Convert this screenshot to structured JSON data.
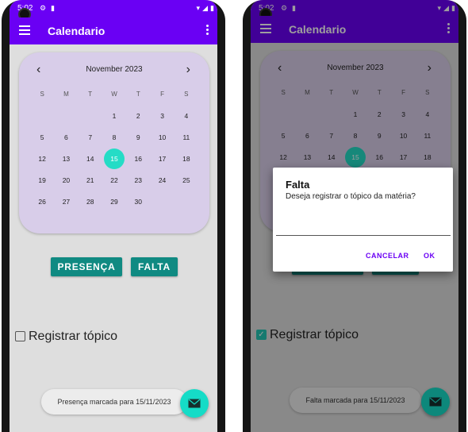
{
  "status_bar": {
    "time": "5:02"
  },
  "app_bar": {
    "title": "Calendario"
  },
  "calendar": {
    "month_label": "November 2023",
    "weekdays": [
      "S",
      "M",
      "T",
      "W",
      "T",
      "F",
      "S"
    ],
    "weeks": [
      [
        "",
        "",
        "",
        "1",
        "2",
        "3",
        "4"
      ],
      [
        "5",
        "6",
        "7",
        "8",
        "9",
        "10",
        "11"
      ],
      [
        "12",
        "13",
        "14",
        "15",
        "16",
        "17",
        "18"
      ],
      [
        "19",
        "20",
        "21",
        "22",
        "23",
        "24",
        "25"
      ],
      [
        "26",
        "27",
        "28",
        "29",
        "30",
        "",
        ""
      ]
    ],
    "selected_day": "15"
  },
  "buttons": {
    "presenca": "PRESENÇA",
    "falta": "FALTA"
  },
  "checkbox": {
    "label": "Registrar tópico"
  },
  "left_screen": {
    "checked": false,
    "toast": "Presença marcada para 15/11/2023"
  },
  "right_screen": {
    "checked": true,
    "toast": "Falta marcada para 15/11/2023"
  },
  "dialog": {
    "title": "Falta",
    "message": "Deseja registrar o tópico da matéria?",
    "input_value": "",
    "cancel_label": "CANCELAR",
    "ok_label": "OK"
  },
  "colors": {
    "primary": "#6a00f4",
    "accent": "#25dcc6",
    "button": "#108a82",
    "calendar_bg": "#d8cde9"
  },
  "icons": {
    "menu": "hamburger-icon",
    "overflow": "more-vert-icon",
    "prev": "chevron-left-icon",
    "next": "chevron-right-icon",
    "fab": "email-icon"
  }
}
